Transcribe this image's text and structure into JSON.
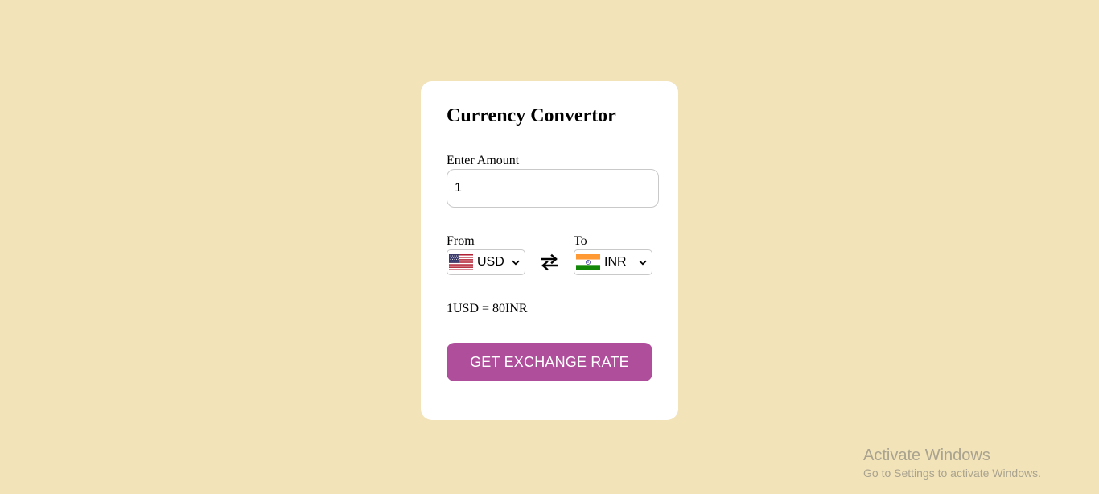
{
  "app": {
    "title": "Currency Convertor"
  },
  "amount": {
    "label": "Enter Amount",
    "value": "1"
  },
  "from": {
    "label": "From",
    "currency": "USD",
    "flag_icon": "us-flag-icon"
  },
  "to": {
    "label": "To",
    "currency": "INR",
    "flag_icon": "india-flag-icon"
  },
  "swap_icon": "swap-arrows-icon",
  "rate_text": "1USD = 80INR",
  "button": {
    "label": "GET EXCHANGE RATE",
    "color": "#af4e9b"
  },
  "watermark": {
    "title": "Activate Windows",
    "subtitle": "Go to Settings to activate Windows."
  },
  "colors": {
    "background": "#f2e3b9",
    "card": "#ffffff"
  }
}
